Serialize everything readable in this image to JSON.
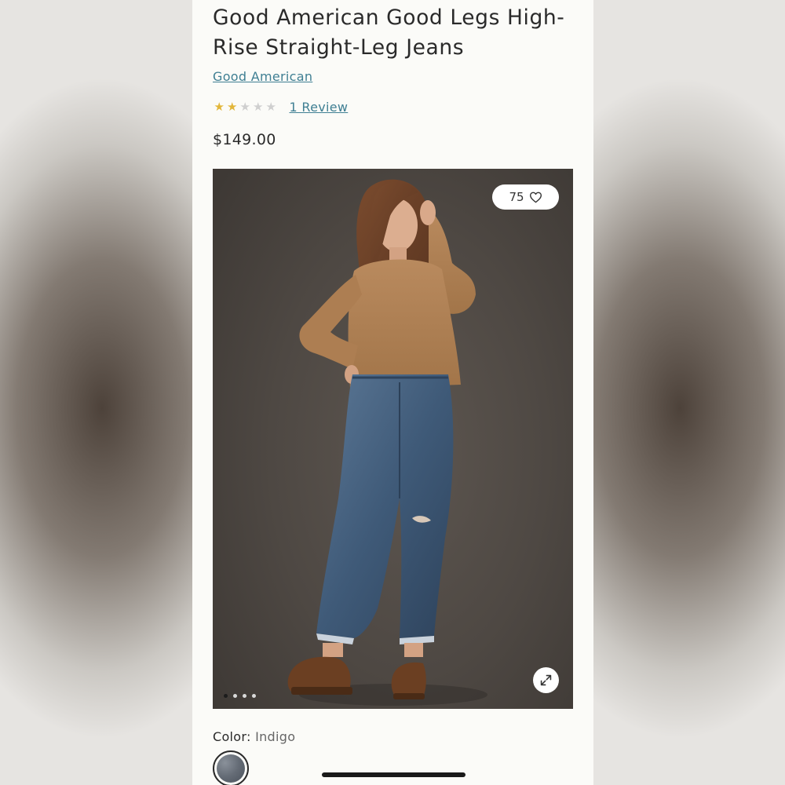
{
  "product": {
    "title": "Good American Good Legs High-Rise Straight-Leg Jeans",
    "brand": "Good American",
    "rating": {
      "value": 2,
      "max": 5
    },
    "review_link": "1 Review",
    "price": "$149.00"
  },
  "gallery": {
    "favorite_count": "75",
    "image_count": 4,
    "active_index": 0
  },
  "color": {
    "label": "Color:",
    "value": "Indigo"
  },
  "icons": {
    "favorite": "heart-icon",
    "expand": "expand-icon",
    "star": "star-icon"
  },
  "colors": {
    "link": "#3f7f93",
    "star_on": "#e2b63a",
    "star_off": "#cfcfcf",
    "text": "#2a2a2a"
  }
}
